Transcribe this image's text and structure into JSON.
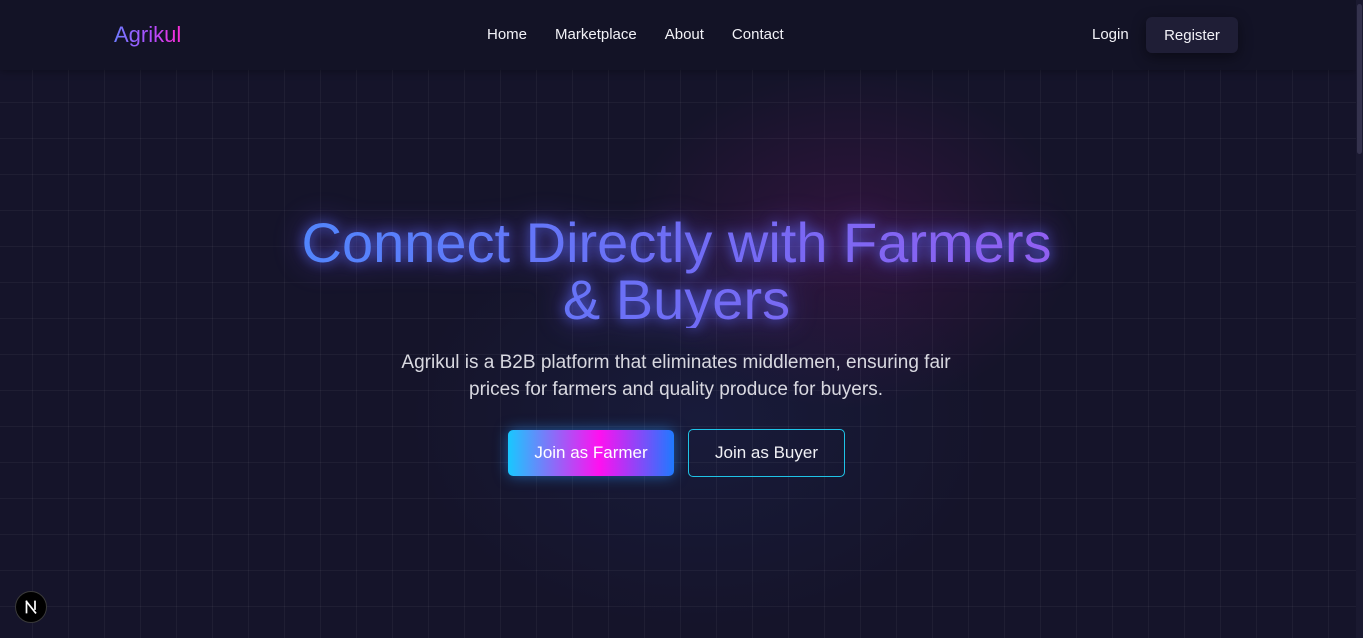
{
  "brand": {
    "name": "Agrikul"
  },
  "nav": {
    "items": [
      {
        "label": "Home"
      },
      {
        "label": "Marketplace"
      },
      {
        "label": "About"
      },
      {
        "label": "Contact"
      }
    ]
  },
  "auth": {
    "login_label": "Login",
    "register_label": "Register"
  },
  "hero": {
    "title_line1": "Connect Directly with Farmers",
    "title_line2": "& Buyers",
    "subtitle_line1": "Agrikul is a B2B platform that eliminates middlemen, ensuring fair",
    "subtitle_line2": "prices for farmers and quality produce for buyers.",
    "primary_cta": "Join as Farmer",
    "secondary_cta": "Join as Buyer"
  },
  "badge": {
    "letter": "N",
    "icon": "nextjs-icon"
  },
  "colors": {
    "background": "#15142a",
    "accent_cyan": "#18c8ff",
    "accent_magenta": "#ff10f0",
    "accent_blue": "#4a8cff",
    "accent_violet": "#9a5cf0"
  }
}
